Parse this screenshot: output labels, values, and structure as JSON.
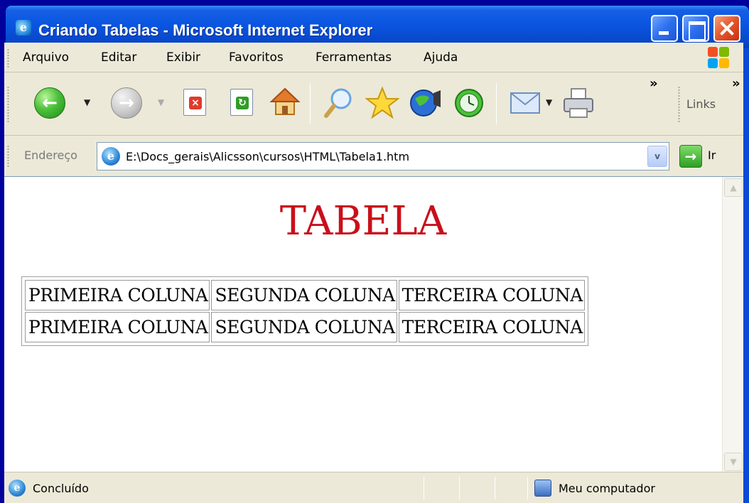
{
  "window": {
    "title": "Criando Tabelas - Microsoft Internet Explorer",
    "title_icon_glyph": "e"
  },
  "menu": {
    "items": [
      "Arquivo",
      "Editar",
      "Exibir",
      "Favoritos",
      "Ferramentas",
      "Ajuda"
    ]
  },
  "toolbar": {
    "back_glyph": "←",
    "forward_glyph": "→",
    "more_glyph": "»",
    "links_label": "Links",
    "buttons": [
      "back-icon",
      "forward-icon",
      "stop-icon",
      "refresh-icon",
      "home-icon",
      "search-icon",
      "favorites-star-icon",
      "media-icon",
      "history-icon",
      "mail-icon",
      "print-icon"
    ]
  },
  "address": {
    "label": "Endereço",
    "value": "E:\\Docs_gerais\\Alicsson\\cursos\\HTML\\Tabela1.htm",
    "go_label": "Ir",
    "dropdown_glyph": "v",
    "go_glyph": "→"
  },
  "page": {
    "heading": "TABELA",
    "heading_color": "#c8101a",
    "table_rows": [
      [
        "PRIMEIRA COLUNA",
        "SEGUNDA COLUNA",
        "TERCEIRA COLUNA"
      ],
      [
        "PRIMEIRA COLUNA",
        "SEGUNDA COLUNA",
        "TERCEIRA COLUNA"
      ]
    ]
  },
  "status": {
    "text": "Concluído",
    "zone": "Meu computador"
  },
  "colors": {
    "desktop": "#00009c",
    "titlebar": "#0a55e0",
    "chrome": "#ece9d8"
  }
}
